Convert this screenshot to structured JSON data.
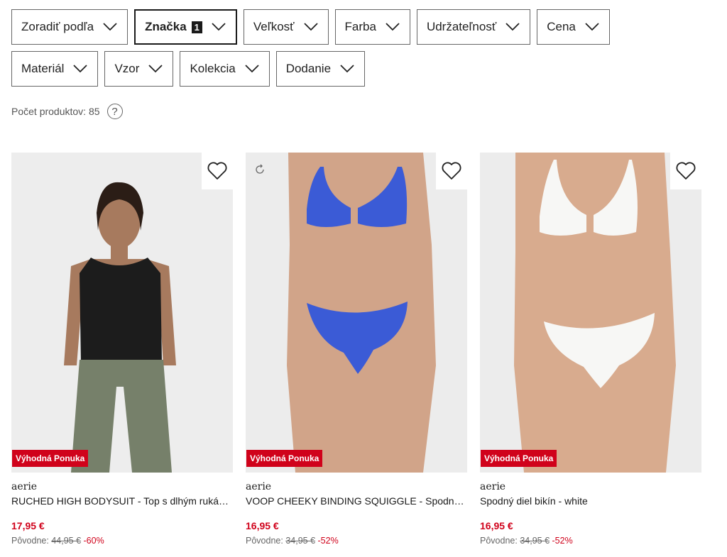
{
  "filters": {
    "row1": [
      {
        "label": "Zoradiť podľa"
      },
      {
        "label": "Značka",
        "badge": "1",
        "active": true
      },
      {
        "label": "Veľkosť"
      },
      {
        "label": "Farba"
      },
      {
        "label": "Udržateľnosť"
      },
      {
        "label": "Cena"
      }
    ],
    "row2": [
      {
        "label": "Materiál"
      },
      {
        "label": "Vzor"
      },
      {
        "label": "Kolekcia"
      },
      {
        "label": "Dodanie"
      }
    ]
  },
  "product_count": "Počet produktov: 85",
  "help_glyph": "?",
  "products": [
    {
      "brand": "aerie",
      "name": "RUCHED HIGH BODYSUIT - Top s dlhým rukávom",
      "price": "17,95 €",
      "orig_label": "Pôvodne:",
      "orig_price": "44,95 €",
      "discount": "-60%",
      "badge": "Výhodná Ponuka",
      "colors": {
        "top": "#1c1c1c",
        "bottom": "#76806a"
      }
    },
    {
      "brand": "aerie",
      "name": "VOOP CHEEKY BINDING SQUIGGLE - Spodný diel bikín",
      "price": "16,95 €",
      "orig_label": "Pôvodne:",
      "orig_price": "34,95 €",
      "discount": "-52%",
      "badge": "Výhodná Ponuka",
      "colors": {
        "top": "#3b5bd6",
        "bottom": "#3b5bd6"
      }
    },
    {
      "brand": "aerie",
      "name": "Spodný diel bikín - white",
      "price": "16,95 €",
      "orig_label": "Pôvodne:",
      "orig_price": "34,95 €",
      "discount": "-52%",
      "badge": "Výhodná Ponuka",
      "colors": {
        "top": "#f7f7f5",
        "bottom": "#f7f7f5"
      }
    }
  ]
}
